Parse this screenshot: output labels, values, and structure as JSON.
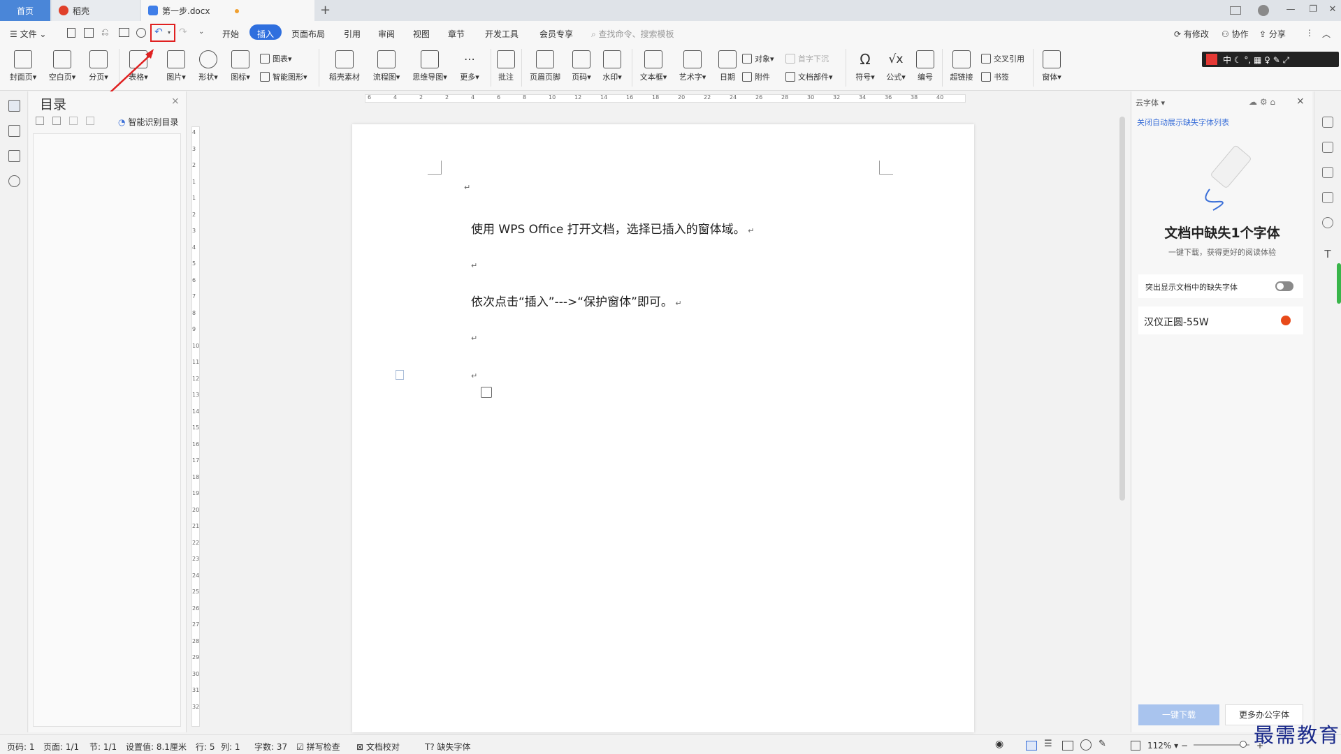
{
  "tabs": {
    "home": "首页",
    "daoke": "稻壳",
    "doc": "第一步.docx"
  },
  "menu": {
    "file": "文件",
    "items": [
      "开始",
      "插入",
      "页面布局",
      "引用",
      "审阅",
      "视图",
      "章节",
      "开发工具",
      "会员专享"
    ],
    "active": "插入",
    "search_placeholder": "查找命令、搜索模板",
    "right": [
      "有修改",
      "协作",
      "分享"
    ]
  },
  "ribbon": {
    "big": [
      "封面页",
      "空白页",
      "分页",
      "表格",
      "图片",
      "形状",
      "图标",
      "稻壳素材",
      "流程图",
      "思维导图",
      "更多",
      "批注",
      "页眉页脚",
      "页码",
      "水印",
      "文本框",
      "艺术字",
      "日期",
      "符号",
      "公式",
      "编号",
      "超链接",
      "窗体"
    ],
    "small": [
      "图表",
      "智能图形",
      "对象",
      "附件",
      "首字下沉",
      "文档部件",
      "交叉引用",
      "书签"
    ]
  },
  "toc": {
    "title": "目录",
    "smart_button": "智能识别目录"
  },
  "document": {
    "line1": "使用 WPS Office 打开文档，选择已插入的窗体域。",
    "line2": "依次点击“插入”--->“保护窗体”即可。"
  },
  "ruler": {
    "h_ticks": [
      "6",
      "4",
      "2",
      "2",
      "4",
      "6",
      "8",
      "10",
      "12",
      "14",
      "16",
      "18",
      "20",
      "22",
      "24",
      "26",
      "28",
      "30",
      "32",
      "34",
      "36",
      "38",
      "40"
    ],
    "v_ticks": [
      "4",
      "3",
      "2",
      "1",
      "1",
      "2",
      "3",
      "4",
      "5",
      "6",
      "7",
      "8",
      "9",
      "10",
      "11",
      "12",
      "13",
      "14",
      "15",
      "16",
      "17",
      "18",
      "19",
      "20",
      "21",
      "22",
      "23",
      "24",
      "25",
      "26",
      "27",
      "28",
      "29",
      "30",
      "31",
      "32"
    ]
  },
  "side_panel": {
    "title": "云字体",
    "link": "关闭自动展示缺失字体列表",
    "heading": "文档中缺失1个字体",
    "subheading": "一键下载，获得更好的阅读体验",
    "toggle_label": "突出显示文档中的缺失字体",
    "font_name": "汉仪正圆-55W",
    "download_button": "一键下载",
    "more_button": "更多办公字体"
  },
  "status": {
    "page_no": "页码: 1",
    "pages": "页面: 1/1",
    "section": "节: 1/1",
    "setting": "设置值: 8.1厘米",
    "row": "行: 5",
    "col": "列: 1",
    "words": "字数: 37",
    "spell": "拼写检查",
    "proof": "文档校对",
    "missing_font": "缺失字体",
    "zoom": "112%"
  },
  "watermark": "最需教育",
  "colors": {
    "accent": "#4a86d8",
    "highlight": "#e02020",
    "tab_active": "#2f6fde"
  }
}
